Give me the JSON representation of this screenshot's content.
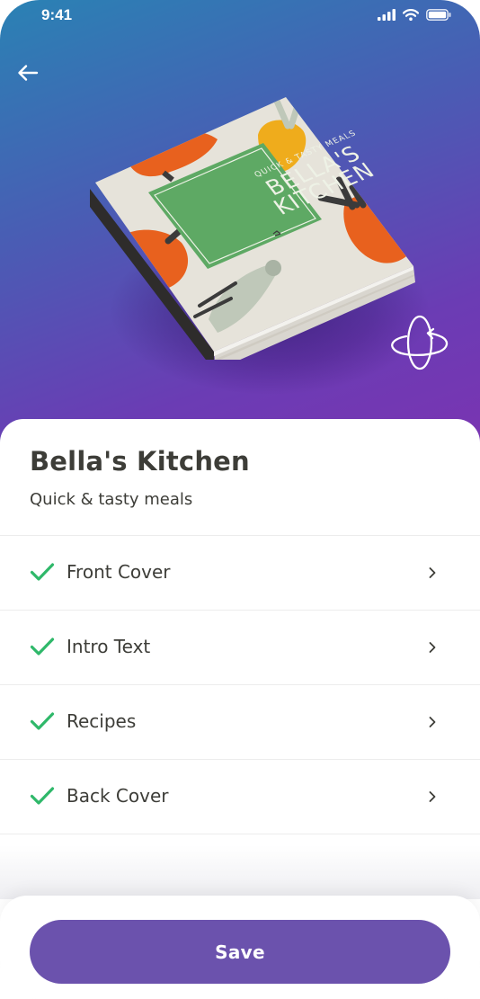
{
  "status_bar": {
    "time": "9:41"
  },
  "hero": {
    "back_icon": "arrow-left-icon",
    "rotate_icon": "rotate-3d-icon",
    "cover": {
      "tagline": "QUICK & TASTY MEALS",
      "title_line_1": "BELLA'S",
      "title_line_2": "KITCHEN",
      "colors": {
        "cover": "#e6e3da",
        "panel": "#5ea964",
        "orange": "#e8611e",
        "yellow": "#efac1c",
        "dark": "#3b3b3b"
      }
    }
  },
  "book": {
    "title": "Bella's Kitchen",
    "subtitle": "Quick & tasty meals"
  },
  "sections": [
    {
      "label": "Front Cover",
      "status": "complete"
    },
    {
      "label": "Intro Text",
      "status": "complete"
    },
    {
      "label": "Recipes",
      "status": "complete"
    },
    {
      "label": "Back Cover",
      "status": "complete"
    }
  ],
  "footer": {
    "save_label": "Save"
  },
  "colors": {
    "accent": "#6b52ad",
    "check": "#2fb86a",
    "text": "#3d3d38"
  }
}
